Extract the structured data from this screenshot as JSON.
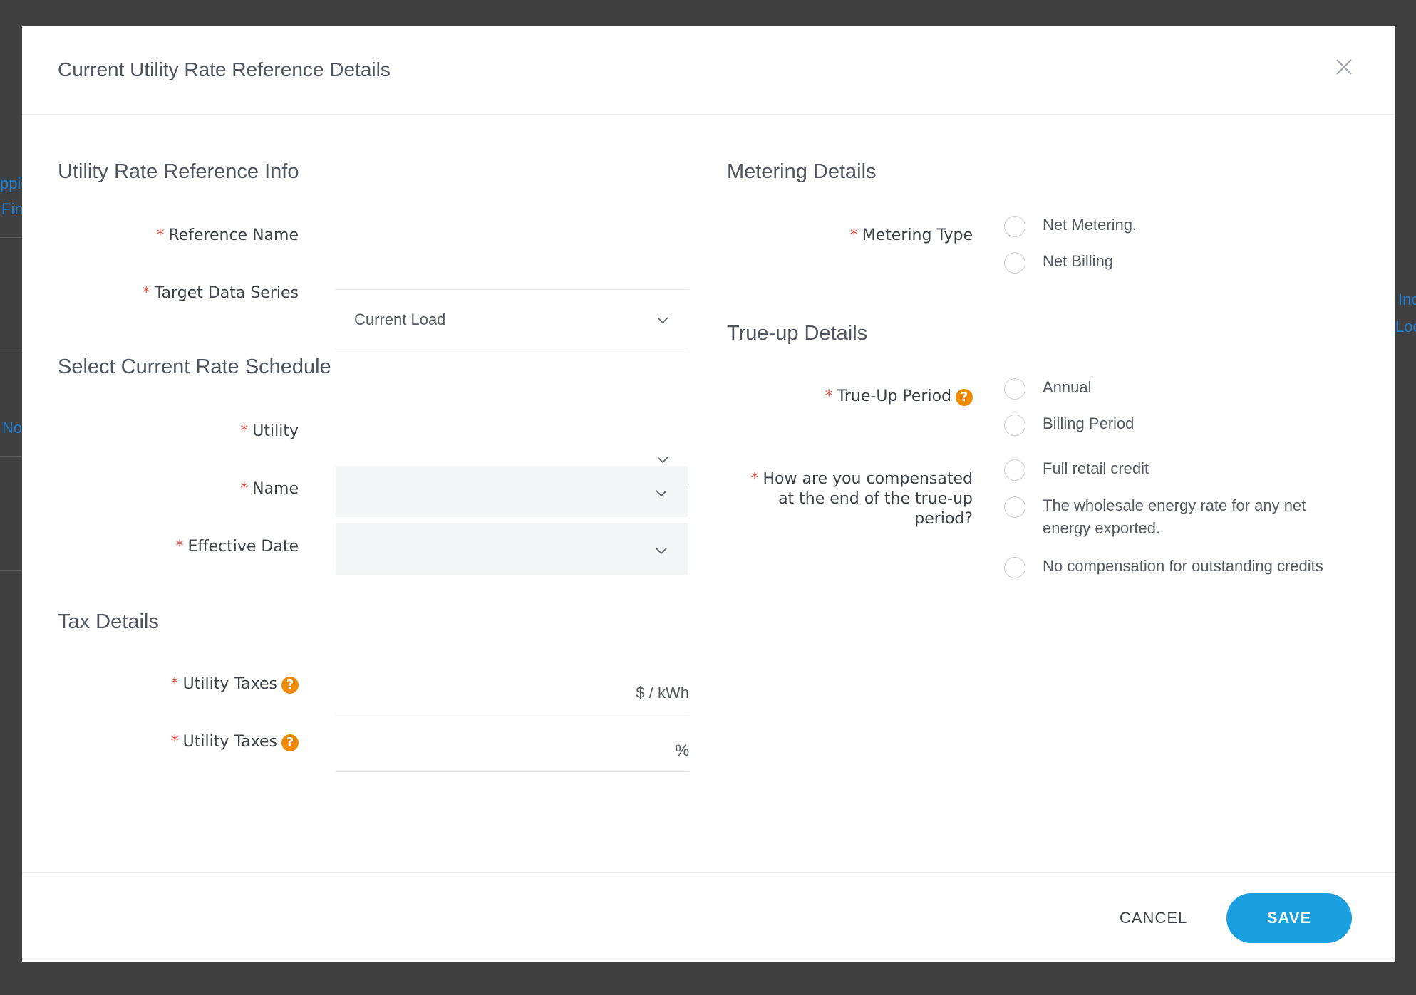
{
  "background": {
    "fragments": [
      "ppie",
      "Fin",
      "No",
      "Inc",
      "Loc"
    ]
  },
  "modal": {
    "title": "Current Utility Rate Reference Details"
  },
  "rate_info": {
    "title": "Utility Rate Reference Info",
    "reference_name_label": "Reference Name",
    "reference_name_value": "",
    "target_series_label": "Target Data Series",
    "target_series_value": "Current Load"
  },
  "rate_schedule": {
    "title": "Select Current Rate Schedule",
    "utility_label": "Utility",
    "utility_value": "",
    "name_label": "Name",
    "name_value": "",
    "effective_date_label": "Effective Date",
    "effective_date_value": ""
  },
  "tax": {
    "title": "Tax Details",
    "utility_taxes_label": "Utility Taxes",
    "kwh_suffix": "$ / kWh",
    "percent_suffix": "%"
  },
  "metering": {
    "title": "Metering Details",
    "type_label": "Metering Type",
    "options": [
      "Net Metering.",
      "Net Billing"
    ]
  },
  "trueup": {
    "title": "True-up Details",
    "period_label": "True-Up Period",
    "period_options": [
      "Annual",
      "Billing Period"
    ],
    "compensation_label": "How are you compensated at the end of the true-up period?",
    "compensation_options": [
      "Full retail credit",
      "The wholesale energy rate for any net energy exported.",
      "No compensation for outstanding credits"
    ]
  },
  "footer": {
    "cancel_label": "CANCEL",
    "save_label": "SAVE"
  },
  "required_mark": "*",
  "help_glyph": "?",
  "colors": {
    "accent": "#1a9fe0",
    "help": "#f08a00",
    "required": "#e0534a"
  }
}
